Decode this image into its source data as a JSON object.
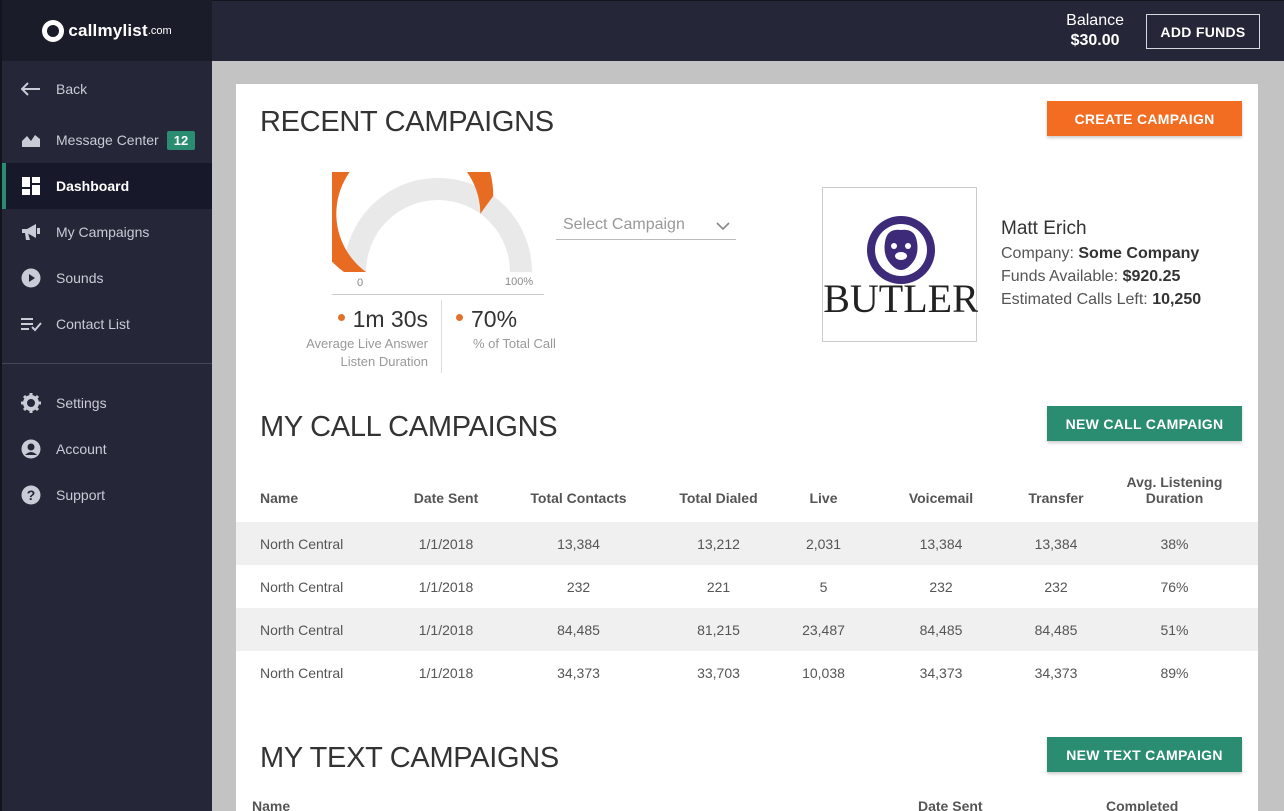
{
  "brand": {
    "name": "callmylist",
    "domain": ".com"
  },
  "topbar": {
    "balance_label": "Balance",
    "balance_amount": "$30.00",
    "add_funds_label": "ADD FUNDS"
  },
  "sidebar": {
    "back_label": "Back",
    "items": [
      {
        "label": "Message Center",
        "badge": "12",
        "icon": "chart-icon"
      },
      {
        "label": "Dashboard",
        "icon": "dashboard-icon",
        "active": true
      },
      {
        "label": "My Campaigns",
        "icon": "megaphone-icon"
      },
      {
        "label": "Sounds",
        "icon": "play-icon"
      },
      {
        "label": "Contact List",
        "icon": "checklist-icon"
      }
    ],
    "secondary": [
      {
        "label": "Settings",
        "icon": "gear-icon"
      },
      {
        "label": "Account",
        "icon": "user-icon"
      },
      {
        "label": "Support",
        "icon": "help-icon"
      }
    ]
  },
  "recent": {
    "title": "RECENT CAMPAIGNS",
    "create_label": "CREATE CAMPAIGN",
    "gauge": {
      "value_percent": 70,
      "min_label": "0",
      "max_label": "100%",
      "fill_color": "#e86b22",
      "track_color": "#e9e9e9"
    },
    "stat1": {
      "value": "1m 30s",
      "label_line1": "Average Live Answer",
      "label_line2": "Listen Duration"
    },
    "stat2": {
      "value": "70%",
      "label": "% of Total Call"
    },
    "select_placeholder": "Select Campaign",
    "profile": {
      "logo_text": "BUTLER",
      "name": "Matt Erich",
      "company_label": "Company:",
      "company": "Some Company",
      "funds_label": "Funds Available:",
      "funds": "$920.25",
      "calls_label": "Estimated Calls Left:",
      "calls": "10,250"
    }
  },
  "call": {
    "title": "MY CALL CAMPAIGNS",
    "new_label": "NEW CALL CAMPAIGN",
    "headers": [
      "Name",
      "Date Sent",
      "Total Contacts",
      "Total Dialed",
      "Live",
      "Voicemail",
      "Transfer",
      "Avg. Listening",
      "Duration"
    ],
    "rows": [
      [
        "North Central",
        "1/1/2018",
        "13,384",
        "13,212",
        "2,031",
        "13,384",
        "13,384",
        "38%"
      ],
      [
        "North Central",
        "1/1/2018",
        "232",
        "221",
        "5",
        "232",
        "232",
        "76%"
      ],
      [
        "North Central",
        "1/1/2018",
        "84,485",
        "81,215",
        "23,487",
        "84,485",
        "84,485",
        "51%"
      ],
      [
        "North Central",
        "1/1/2018",
        "34,373",
        "33,703",
        "10,038",
        "34,373",
        "34,373",
        "89%"
      ]
    ]
  },
  "text": {
    "title": "MY TEXT CAMPAIGNS",
    "new_label": "NEW TEXT CAMPAIGN",
    "headers": [
      "Name",
      "Date Sent",
      "Completed"
    ]
  },
  "colors": {
    "accent_green": "#2a8d72",
    "accent_orange": "#f26c22",
    "sidebar": "#252638"
  }
}
